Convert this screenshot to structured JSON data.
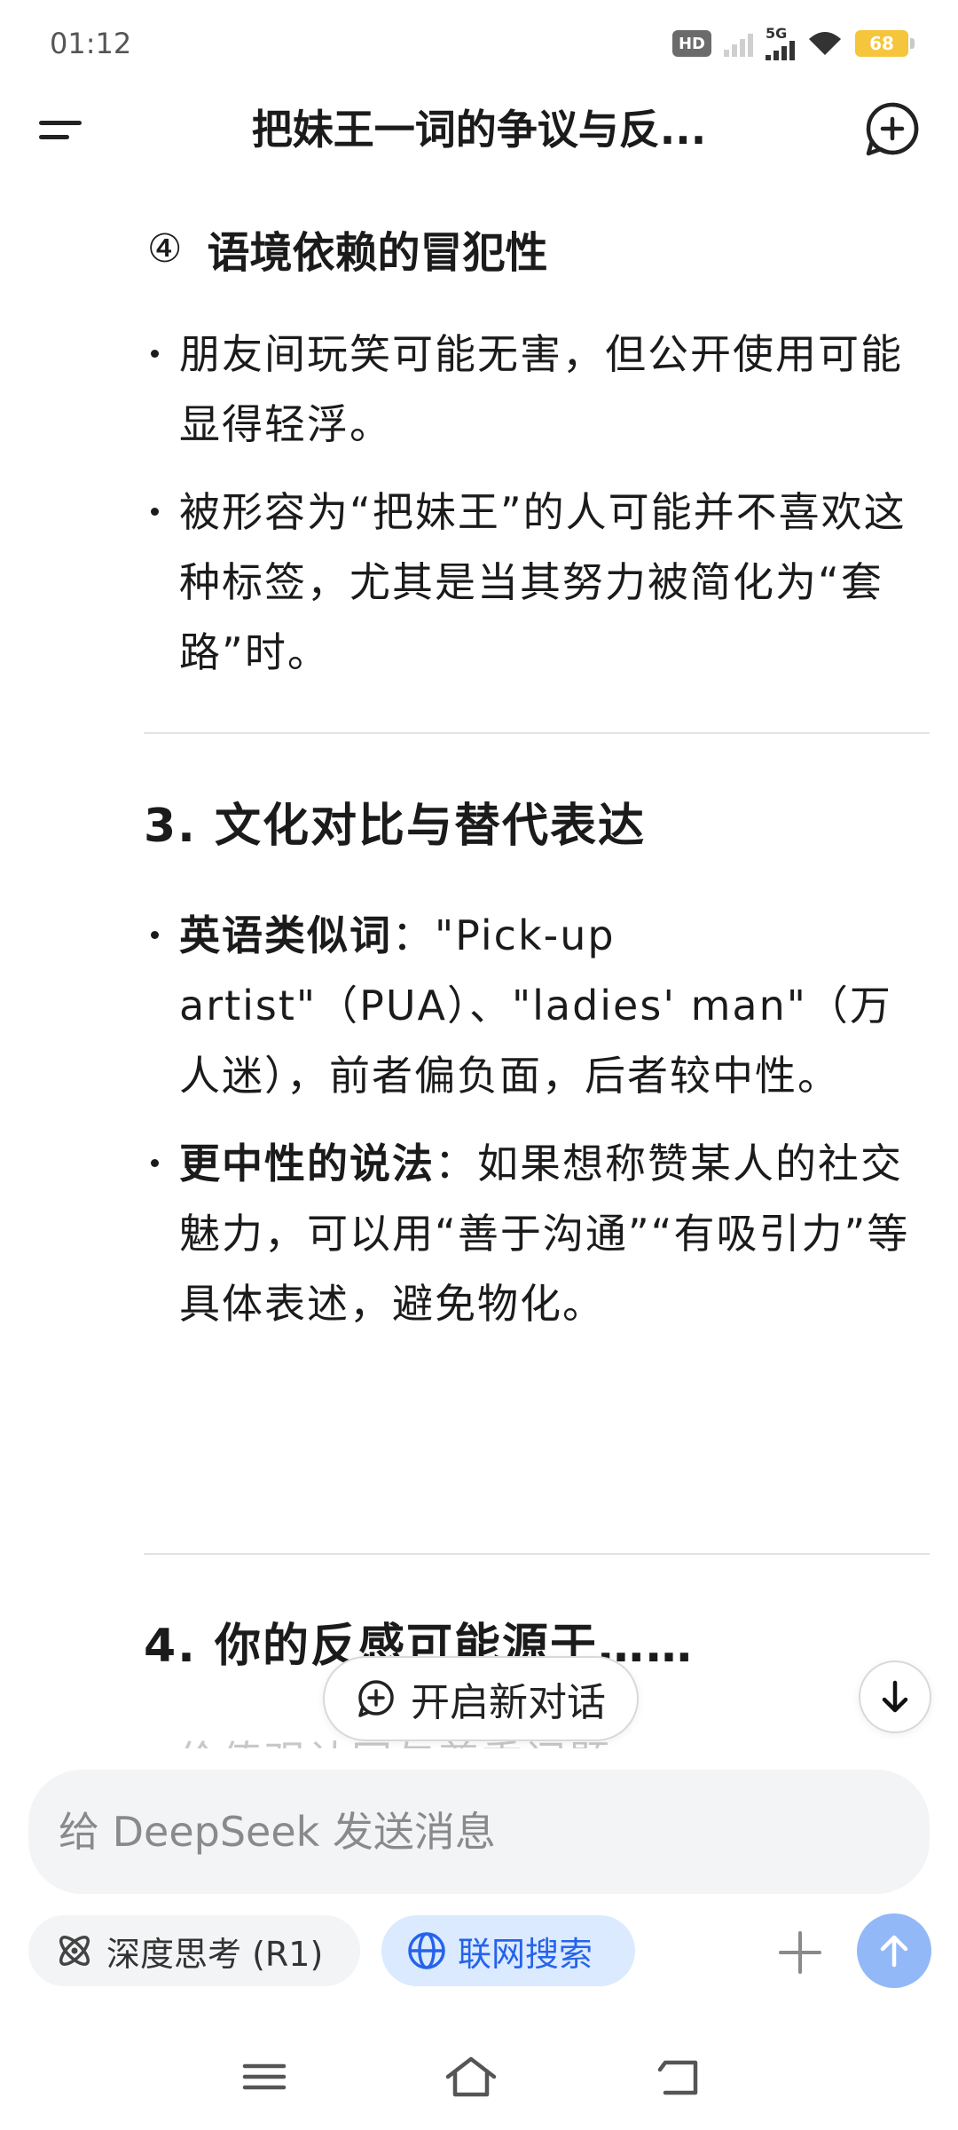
{
  "status_bar": {
    "time": "01:12",
    "hd_label": "HD",
    "network_label": "5G",
    "battery_level": "68",
    "battery_color": "#f5c53b"
  },
  "appbar": {
    "title": "把妹王一词的争议与反...",
    "menu_icon": "menu-icon",
    "new_chat_icon": "new-chat-icon"
  },
  "content": {
    "subsection": {
      "number": "④",
      "title": "语境依赖的冒犯性"
    },
    "subsection_bullets": [
      "朋友间玩笑可能无害，但公开使用可能显得轻浮。",
      "被形容为“把妹王”的人可能并不喜欢这种标签，尤其是当其努力被简化为“套路”时。"
    ],
    "section3": {
      "title": "3. 文化对比与替代表达",
      "bullets": [
        {
          "bold": "英语类似词",
          "text": "：\"Pick-up artist\"（PUA）、\"ladies' man\"（万人迷），前者偏负面，后者较中性。"
        },
        {
          "bold": "更中性的说法",
          "text": "：如果想称赞某人的社交魅力，可以用“善于沟通”“有吸引力”等具体表述，避免物化。"
        }
      ]
    },
    "section4": {
      "title": "4. 你的反感可能源于……",
      "faded_line": "价值观认同与尊重问题"
    }
  },
  "floating": {
    "new_conversation": "开启新对话",
    "scroll_down_icon": "arrow-down-icon"
  },
  "composer": {
    "placeholder": "给 DeepSeek 发送消息",
    "deep_think": "深度思考 (R1)",
    "web_search": "联网搜索",
    "accent_color": "#2563eb",
    "send_color": "#93b8f8"
  }
}
